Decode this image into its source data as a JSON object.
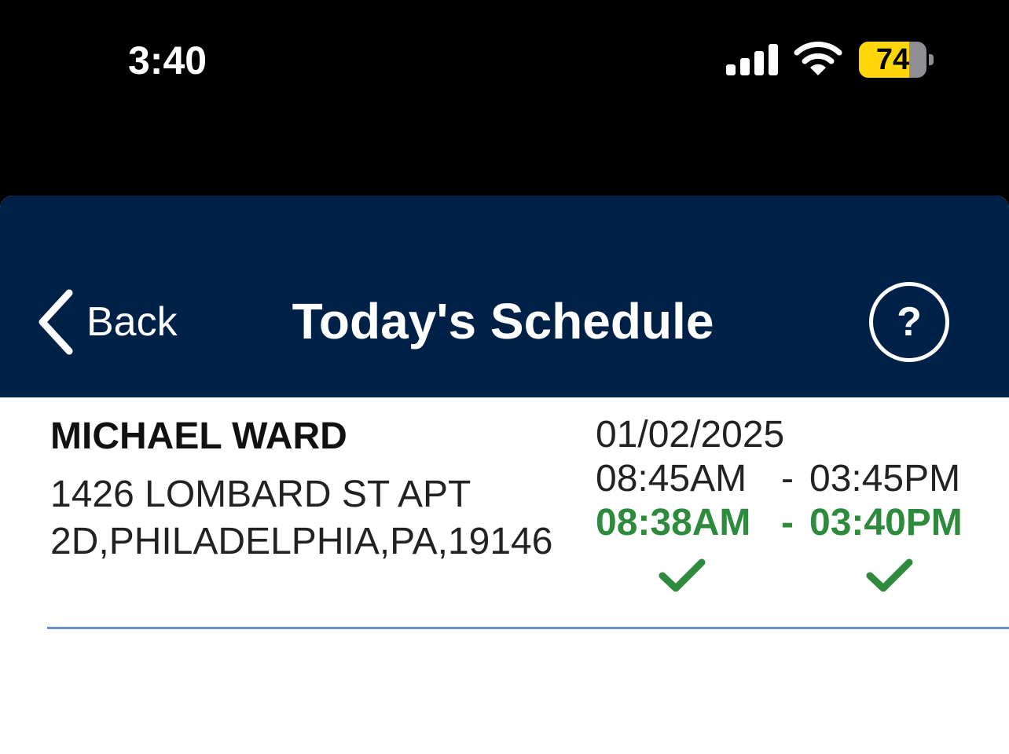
{
  "status_bar": {
    "time": "3:40",
    "battery_percent": 74,
    "battery_label": "74",
    "signal_icon": "cellular-signal-icon",
    "wifi_icon": "wifi-icon"
  },
  "nav": {
    "back_label": "Back",
    "title": "Today's Schedule",
    "help_label": "?"
  },
  "schedule": [
    {
      "client_name": "MICHAEL WARD",
      "address": "1426 LOMBARD ST APT 2D,PHILADELPHIA,PA,19146",
      "date": "01/02/2025",
      "scheduled_start": "08:45AM",
      "scheduled_end": "03:45PM",
      "actual_start": "08:38AM",
      "actual_end": "03:40PM",
      "dash": "-",
      "check_in_complete": true,
      "check_out_complete": true
    }
  ],
  "colors": {
    "nav_background": "#002147",
    "actual_time": "#2e8b3e",
    "divider": "#6b8fcb",
    "battery_fill": "#ffd60a"
  }
}
